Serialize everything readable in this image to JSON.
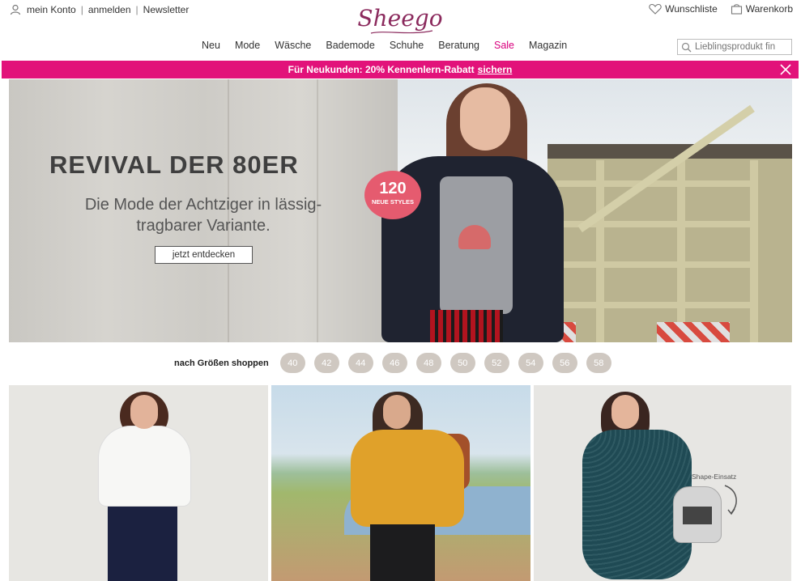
{
  "header": {
    "account_label": "mein Konto",
    "login_label": "anmelden",
    "newsletter_label": "Newsletter",
    "logo_text": "Sheego",
    "wishlist_label": "Wunschliste",
    "cart_label": "Warenkorb",
    "search_placeholder": "Lieblingsprodukt fin"
  },
  "nav": {
    "items": [
      {
        "label": "Neu"
      },
      {
        "label": "Mode"
      },
      {
        "label": "Wäsche"
      },
      {
        "label": "Bademode"
      },
      {
        "label": "Schuhe"
      },
      {
        "label": "Beratung"
      },
      {
        "label": "Sale"
      },
      {
        "label": "Magazin"
      }
    ]
  },
  "promo": {
    "text": "Für Neukunden: 20% Kennenlern-Rabatt",
    "link": "sichern"
  },
  "hero": {
    "title": "REVIVAL DER 80ER",
    "subtitle": "Die Mode der Achtziger in lässig-tragbarer Variante.",
    "cta": "jetzt entdecken",
    "badge_number": "120",
    "badge_text": "NEUE STYLES"
  },
  "sizes": {
    "label": "nach Größen shoppen",
    "values": [
      "40",
      "42",
      "44",
      "46",
      "48",
      "50",
      "52",
      "54",
      "56",
      "58"
    ]
  },
  "tiles": {
    "shape_label": "Shape-Einsatz"
  },
  "colors": {
    "brand": "#8b2a5d",
    "promo": "#e2127a",
    "sale": "#d9007e",
    "size_pill": "#cfc8c1",
    "badge": "#e55b6f"
  }
}
